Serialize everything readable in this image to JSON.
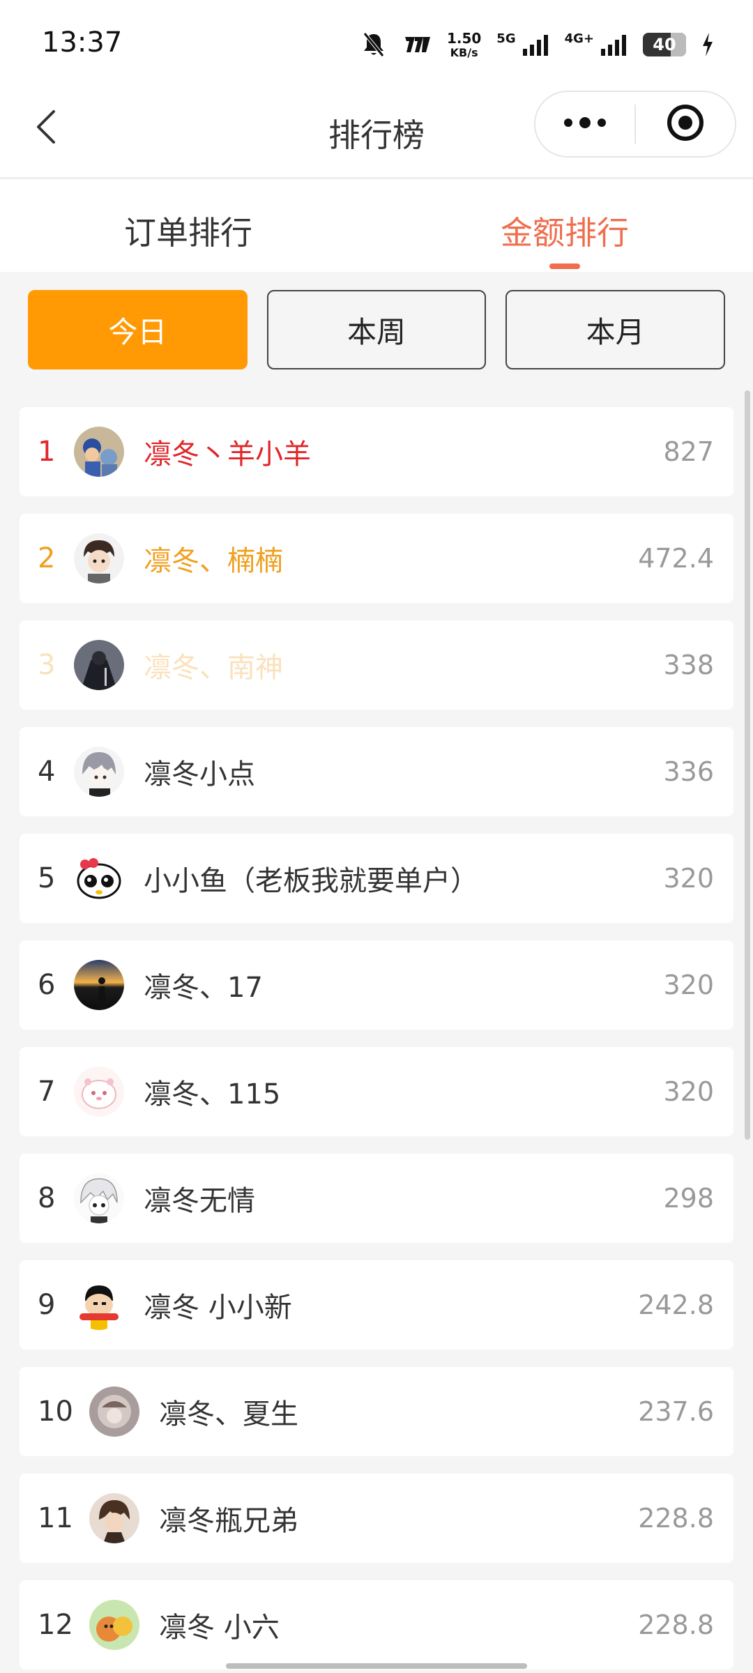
{
  "status_bar": {
    "time": "13:37",
    "net_speed_value": "1.50",
    "net_speed_unit": "KB/s",
    "net_5g": "5G",
    "net_4g": "4G+",
    "battery_level": "40",
    "icons": [
      "mute-icon",
      "hd-icon",
      "signal-icon",
      "signal-icon",
      "battery-icon",
      "charging-icon"
    ]
  },
  "nav": {
    "title": "排行榜",
    "back_icon": "chevron-left-icon",
    "more_icon": "more-dots-icon",
    "close_icon": "target-icon"
  },
  "tabs": [
    {
      "label": "订单排行",
      "active": false
    },
    {
      "label": "金额排行",
      "active": true
    }
  ],
  "periods": [
    {
      "label": "今日",
      "active": true
    },
    {
      "label": "本周",
      "active": false
    },
    {
      "label": "本月",
      "active": false
    }
  ],
  "ranking": [
    {
      "rank": "1",
      "name": "凛冬丶羊小羊",
      "value": "827"
    },
    {
      "rank": "2",
      "name": "凛冬、楠楠",
      "value": "472.4"
    },
    {
      "rank": "3",
      "name": "凛冬、南神",
      "value": "338"
    },
    {
      "rank": "4",
      "name": "凛冬小点",
      "value": "336"
    },
    {
      "rank": "5",
      "name": "小小鱼（老板我就要单户）",
      "value": "320"
    },
    {
      "rank": "6",
      "name": "凛冬、17",
      "value": "320"
    },
    {
      "rank": "7",
      "name": "凛冬、115",
      "value": "320"
    },
    {
      "rank": "8",
      "name": "凛冬无情",
      "value": "298"
    },
    {
      "rank": "9",
      "name": "凛冬 小小新",
      "value": "242.8"
    },
    {
      "rank": "10",
      "name": "凛冬、夏生",
      "value": "237.6"
    },
    {
      "rank": "11",
      "name": "凛冬瓶兄弟",
      "value": "228.8"
    },
    {
      "rank": "12",
      "name": "凛冬 小六",
      "value": "228.8"
    }
  ],
  "colors": {
    "accent": "#ee6e4e",
    "active_button": "#ff9a04",
    "rank1": "#e0262a",
    "rank2": "#f0a020",
    "rank3": "#fbe1bd"
  }
}
